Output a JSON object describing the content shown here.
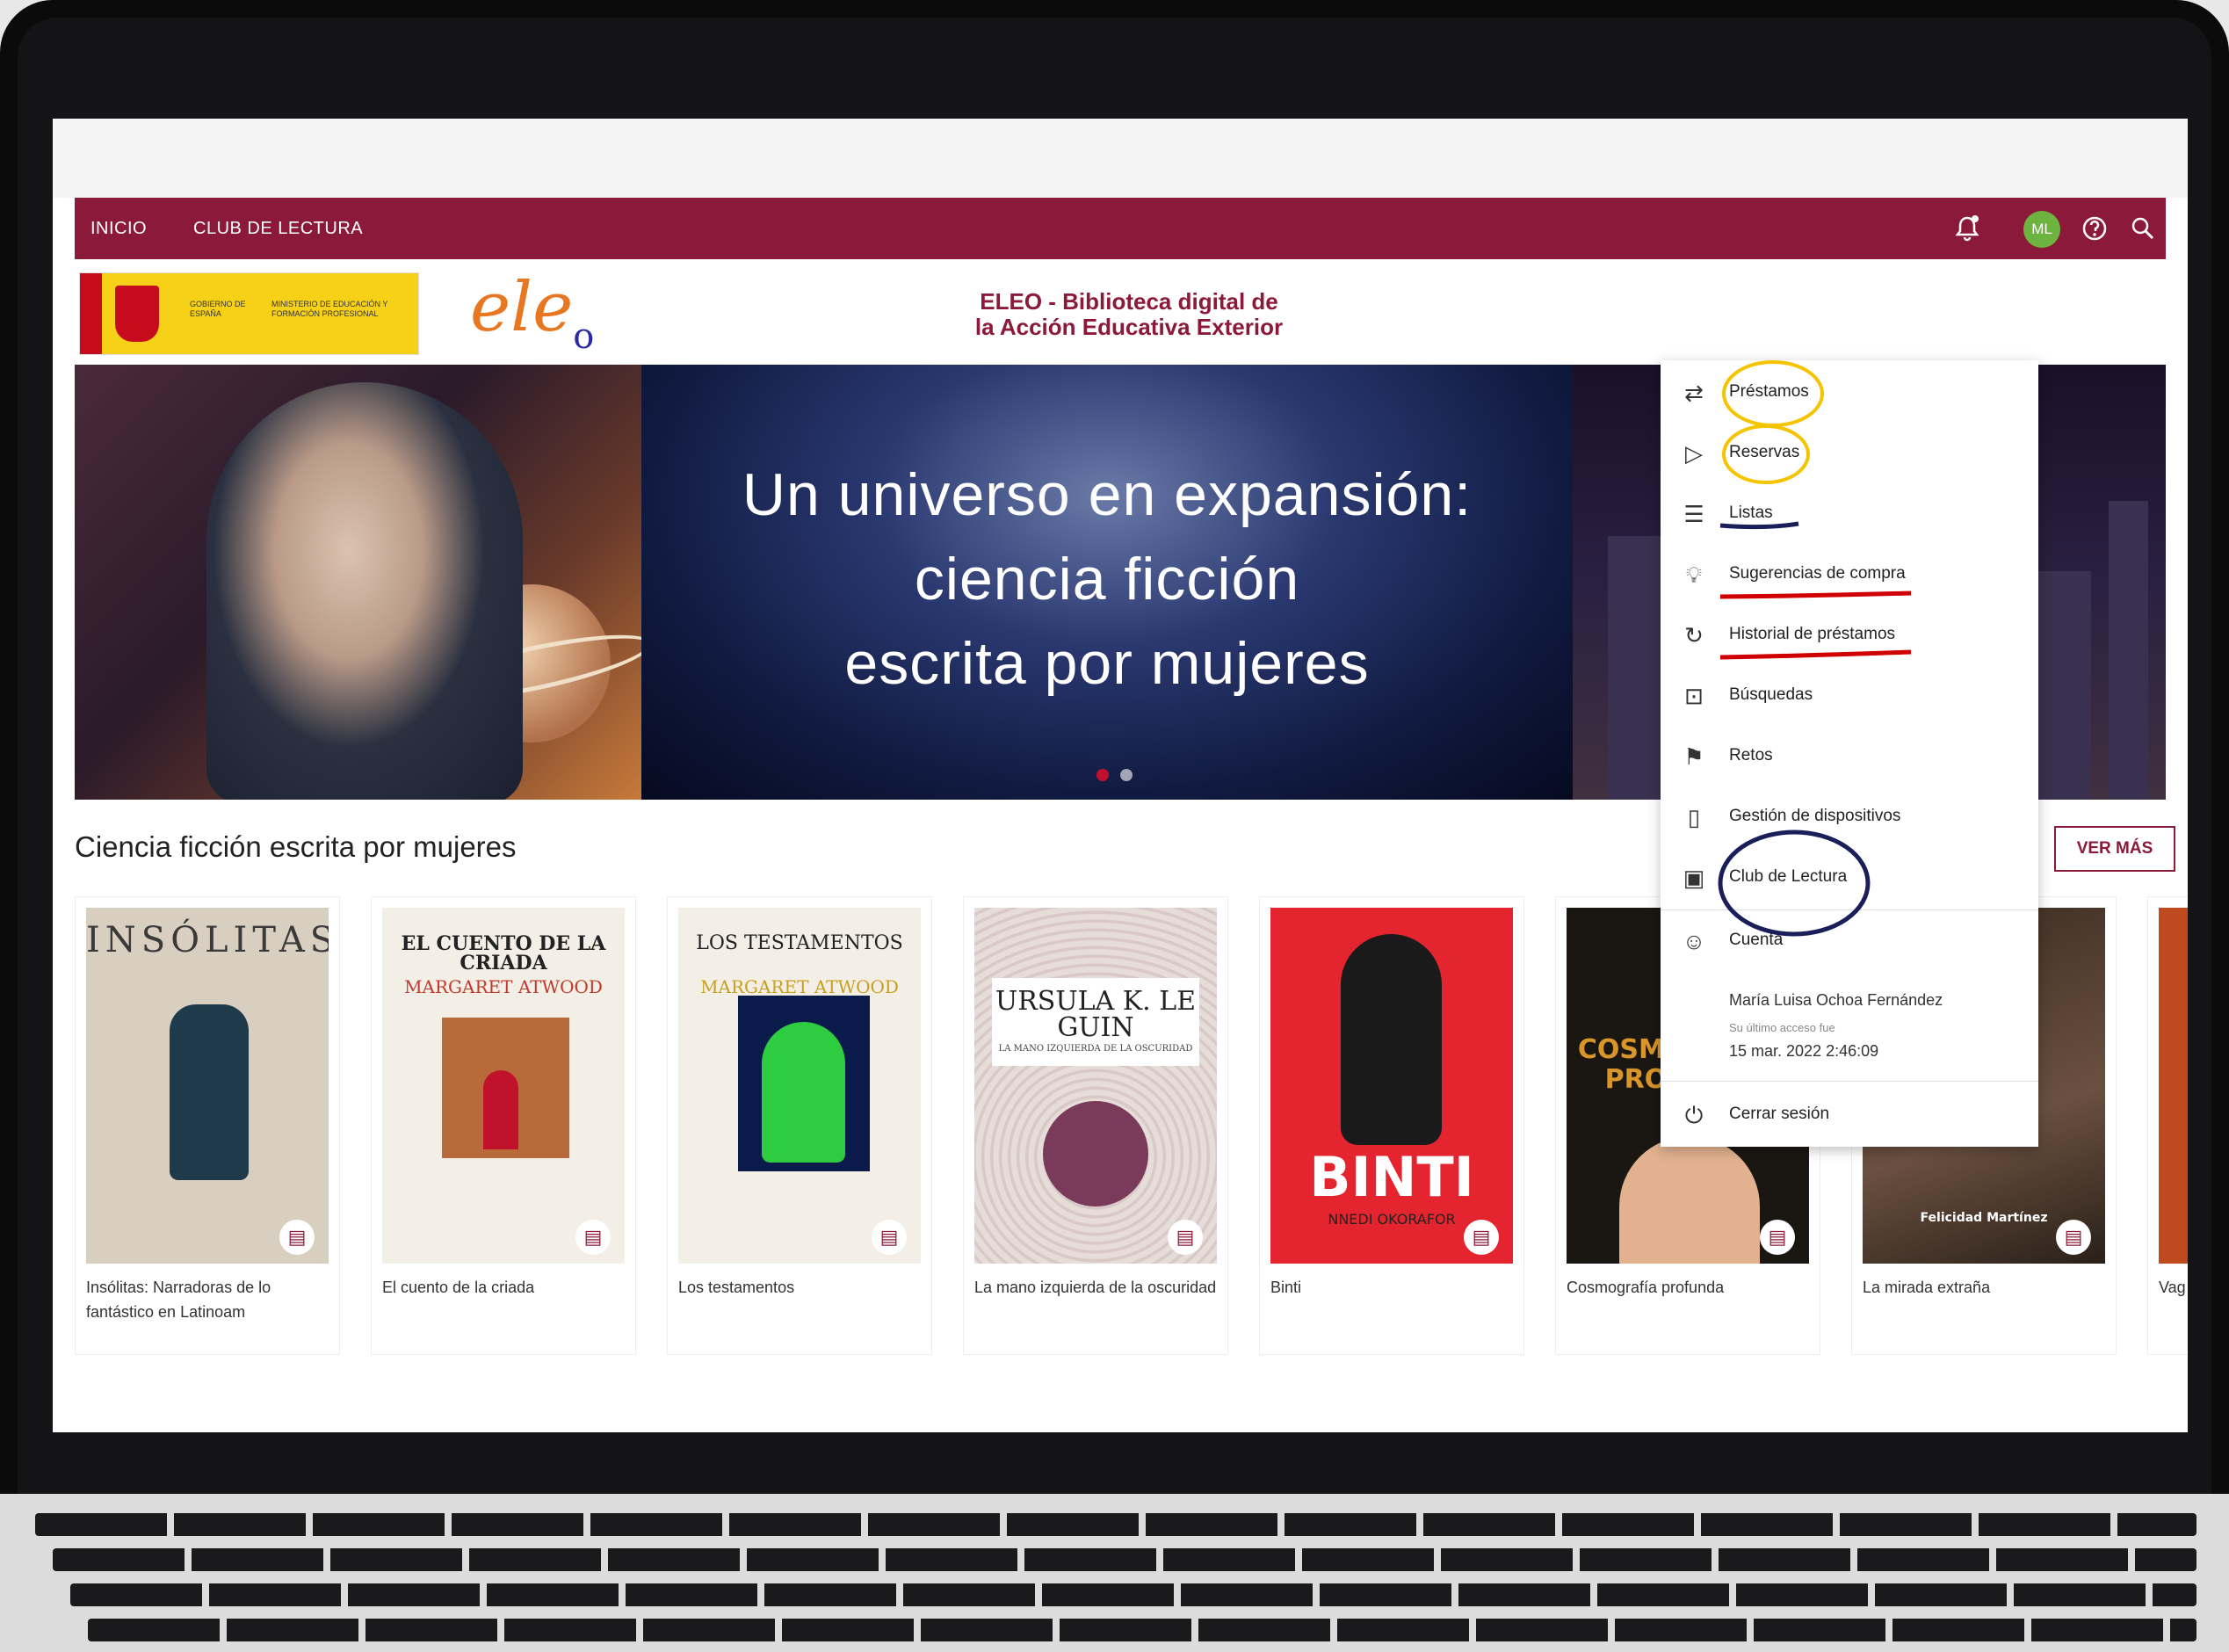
{
  "nav": {
    "inicio": "INICIO",
    "club": "CLUB DE LECTURA",
    "avatar_initials": "ML"
  },
  "header": {
    "site_title_line1": "ELEO - Biblioteca digital de",
    "site_title_line2": "la Acción Educativa Exterior",
    "logo_eleo": "ele",
    "logo_eleo_sub": "o",
    "gov_text_1": "GOBIERNO DE ESPAÑA",
    "gov_text_2": "MINISTERIO DE EDUCACIÓN Y FORMACIÓN PROFESIONAL"
  },
  "banner": {
    "line1": "Un universo en expansión:",
    "line2": "ciencia ficción",
    "line3": "escrita por mujeres"
  },
  "section": {
    "title": "Ciencia ficción escrita por mujeres",
    "ver_mas": "VER MÁS"
  },
  "books": [
    {
      "title": "Insólitas: Narradoras de lo fantástico en Latinoam",
      "cover_title": "INSÓLITAS"
    },
    {
      "title": "El cuento de la criada",
      "cover_title": "EL CUENTO DE LA CRIADA",
      "cover_author": "MARGARET ATWOOD"
    },
    {
      "title": "Los testamentos",
      "cover_title": "LOS TESTAMENTOS",
      "cover_author": "MARGARET ATWOOD"
    },
    {
      "title": "La mano izquierda de la oscuridad",
      "cover_title": "URSULA K. LE GUIN",
      "cover_sub": "LA MANO IZQUIERDA DE LA OSCURIDAD"
    },
    {
      "title": "Binti",
      "cover_title": "BINTI",
      "cover_author": "NNEDI OKORAFOR"
    },
    {
      "title": "Cosmografía profunda",
      "cover_title": "COSMOGRAFÍA PROFUNDA"
    },
    {
      "title": "La mirada extraña",
      "cover_author": "Felicidad Martínez"
    },
    {
      "title": "Vag"
    }
  ],
  "menu": {
    "items": [
      "Préstamos",
      "Reservas",
      "Listas",
      "Sugerencias de compra",
      "Historial de préstamos",
      "Búsquedas",
      "Retos",
      "Gestión de dispositivos",
      "Club de Lectura",
      "Cuenta"
    ],
    "user_name": "María Luisa Ochoa Fernández",
    "last_access_label": "Su último acceso fue",
    "last_access_date": "15 mar. 2022 2:46:09",
    "logout": "Cerrar sesión"
  },
  "colors": {
    "brand": "#8b1a3a",
    "avatar": "#6db33f",
    "highlight_yellow": "#f5c400",
    "highlight_red": "#d10000",
    "highlight_navy": "#1a1f5a"
  }
}
